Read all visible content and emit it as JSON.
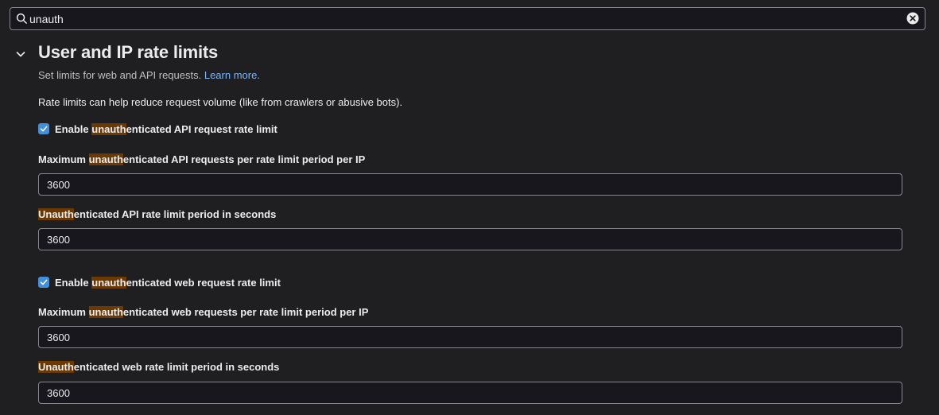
{
  "search": {
    "value": "unauth",
    "highlight": "#6b3a04"
  },
  "section": {
    "title": "User and IP rate limits",
    "description": "Set limits for web and API requests.",
    "learn_more": "Learn more.",
    "intro": "Rate limits can help reduce request volume (like from crawlers or abusive bots)."
  },
  "api": {
    "enable": {
      "pre": "Enable ",
      "hl": "unauth",
      "post": "enticated API request rate limit",
      "checked": true
    },
    "max_requests": {
      "pre": "Maximum ",
      "hl": "unauth",
      "post": "enticated API requests per rate limit period per IP",
      "value": "3600"
    },
    "period": {
      "pre": "",
      "hl": "Unauth",
      "post": "enticated API rate limit period in seconds",
      "value": "3600"
    }
  },
  "web": {
    "enable": {
      "pre": "Enable ",
      "hl": "unauth",
      "post": "enticated web request rate limit",
      "checked": true
    },
    "max_requests": {
      "pre": "Maximum ",
      "hl": "unauth",
      "post": "enticated web requests per rate limit period per IP",
      "value": "3600"
    },
    "period": {
      "pre": "",
      "hl": "Unauth",
      "post": "enticated web rate limit period in seconds",
      "value": "3600"
    }
  },
  "colors": {
    "background": "#1f1f22",
    "checkbox": "#428fdc",
    "link": "#7cb4f7"
  }
}
